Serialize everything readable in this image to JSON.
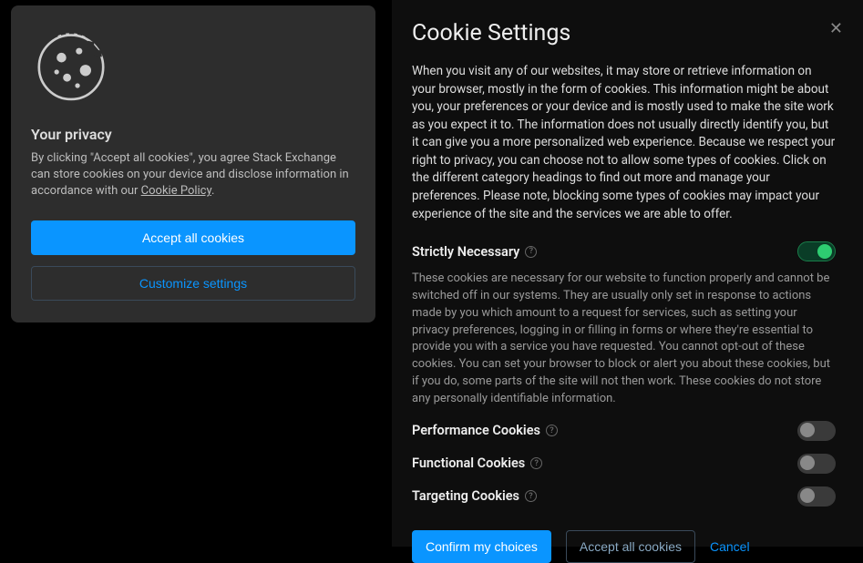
{
  "left": {
    "title": "Your privacy",
    "desc_prefix": "By clicking \"Accept all cookies\", you agree Stack Exchange can store cookies on your device and disclose information in accordance with our ",
    "policy_link": "Cookie Policy",
    "desc_suffix": ".",
    "accept_label": "Accept all cookies",
    "customize_label": "Customize settings"
  },
  "right": {
    "title": "Cookie Settings",
    "close_glyph": "✕",
    "intro": "When you visit any of our websites, it may store or retrieve information on your browser, mostly in the form of cookies. This information might be about you, your preferences or your device and is mostly used to make the site work as you expect it to. The information does not usually directly identify you, but it can give you a more personalized web experience. Because we respect your right to privacy, you can choose not to allow some types of cookies. Click on the different category headings to find out more and manage your preferences. Please note, blocking some types of cookies may impact your experience of the site and the services we are able to offer.",
    "categories": [
      {
        "title": "Strictly Necessary",
        "help": "?",
        "enabled": true,
        "locked": true,
        "desc": "These cookies are necessary for our website to function properly and cannot be switched off in our systems. They are usually only set in response to actions made by you which amount to a request for services, such as setting your privacy preferences, logging in or filling in forms or where they're essential to provide you with a service you have requested. You cannot opt-out of these cookies. You can set your browser to block or alert you about these cookies, but if you do, some parts of the site will not then work. These cookies do not store any personally identifiable information."
      },
      {
        "title": "Performance Cookies",
        "help": "?",
        "enabled": false,
        "locked": false
      },
      {
        "title": "Functional Cookies",
        "help": "?",
        "enabled": false,
        "locked": false
      },
      {
        "title": "Targeting Cookies",
        "help": "?",
        "enabled": false,
        "locked": false
      }
    ],
    "confirm_label": "Confirm my choices",
    "accept_label": "Accept all cookies",
    "cancel_label": "Cancel"
  }
}
